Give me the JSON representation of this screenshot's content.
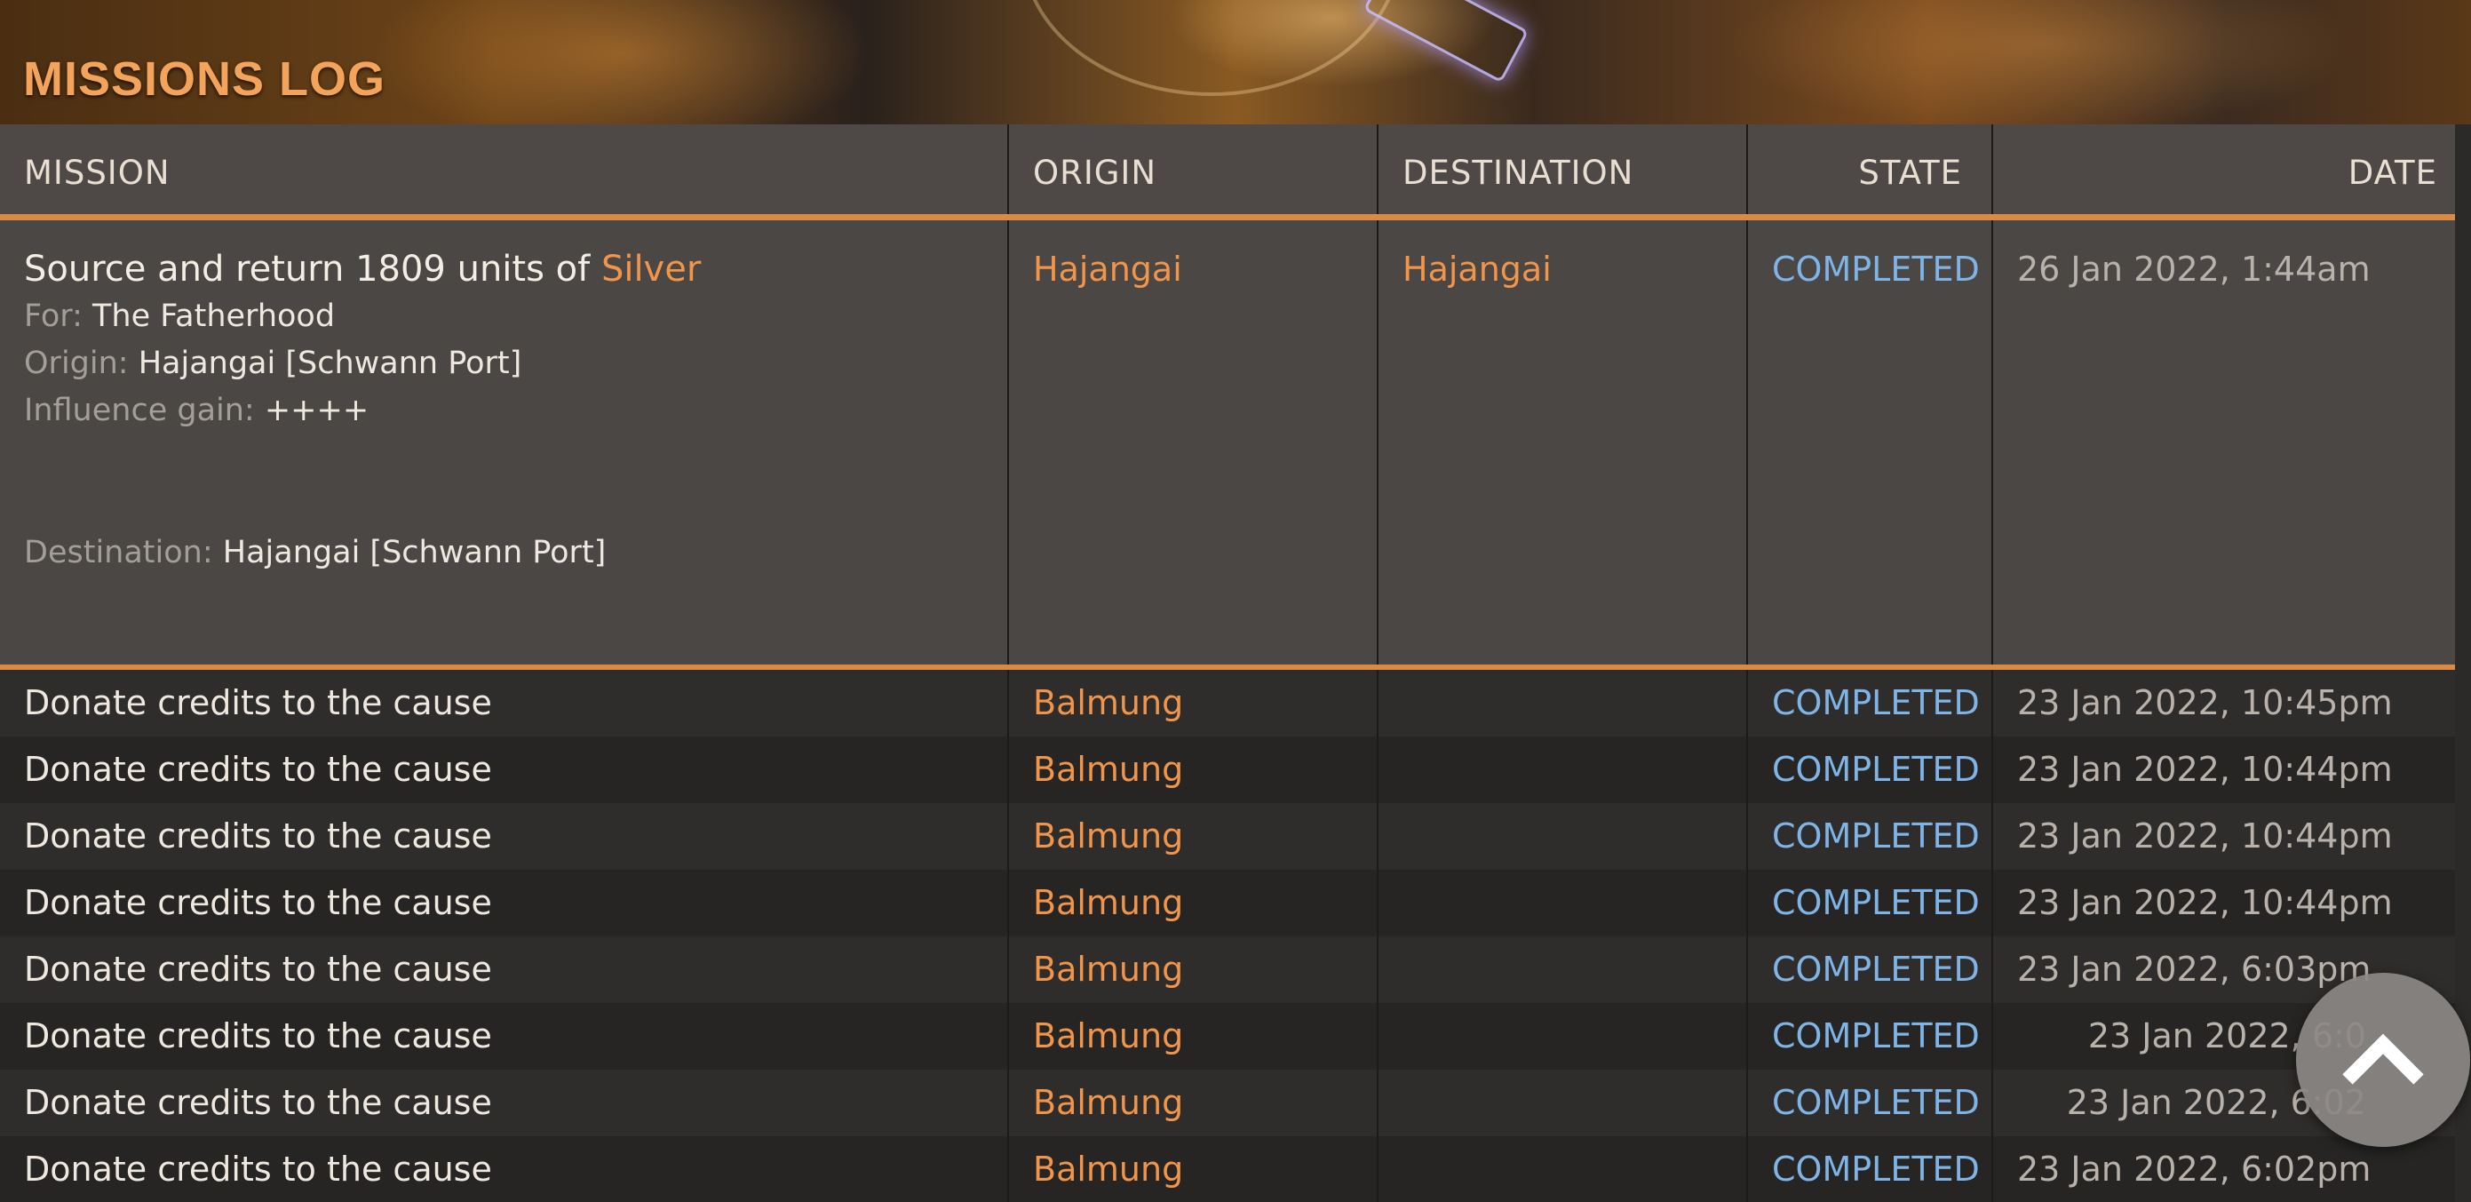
{
  "banner": {
    "title": "MISSIONS LOG"
  },
  "columns": [
    "MISSION",
    "ORIGIN",
    "DESTINATION",
    "STATE",
    "DATE"
  ],
  "expanded": {
    "title_prefix": "Source and return 1809 units of",
    "commodity": "Silver",
    "for_label": "For:",
    "for_value": "The Fatherhood",
    "origin_label": "Origin:",
    "origin_value": "Hajangai [Schwann Port]",
    "influence_label": "Influence gain:",
    "influence_value": "++++",
    "destination_label": "Destination:",
    "destination_value": "Hajangai [Schwann Port]",
    "origin": "Hajangai",
    "destination": "Hajangai",
    "state": "COMPLETED",
    "date": "26 Jan 2022, 1:44am"
  },
  "rows": [
    {
      "mission": "Donate credits to the cause",
      "origin": "Balmung",
      "destination": "",
      "state": "COMPLETED",
      "date": "23 Jan 2022, 10:45pm"
    },
    {
      "mission": "Donate credits to the cause",
      "origin": "Balmung",
      "destination": "",
      "state": "COMPLETED",
      "date": "23 Jan 2022, 10:44pm"
    },
    {
      "mission": "Donate credits to the cause",
      "origin": "Balmung",
      "destination": "",
      "state": "COMPLETED",
      "date": "23 Jan 2022, 10:44pm"
    },
    {
      "mission": "Donate credits to the cause",
      "origin": "Balmung",
      "destination": "",
      "state": "COMPLETED",
      "date": "23 Jan 2022, 10:44pm"
    },
    {
      "mission": "Donate credits to the cause",
      "origin": "Balmung",
      "destination": "",
      "state": "COMPLETED",
      "date": "23 Jan 2022, 6:03pm"
    },
    {
      "mission": "Donate credits to the cause",
      "origin": "Balmung",
      "destination": "",
      "state": "COMPLETED",
      "date": "23 Jan 2022, 6:0"
    },
    {
      "mission": "Donate credits to the cause",
      "origin": "Balmung",
      "destination": "",
      "state": "COMPLETED",
      "date": "23 Jan 2022, 6:02"
    },
    {
      "mission": "Donate credits to the cause",
      "origin": "Balmung",
      "destination": "",
      "state": "COMPLETED",
      "date": "23 Jan 2022, 6:02pm"
    }
  ],
  "icons": {
    "back_to_top": "chevron-up-icon"
  },
  "colors": {
    "accent": "#d98a45",
    "location": "#f0954a",
    "state_completed": "#7fb4e6"
  }
}
